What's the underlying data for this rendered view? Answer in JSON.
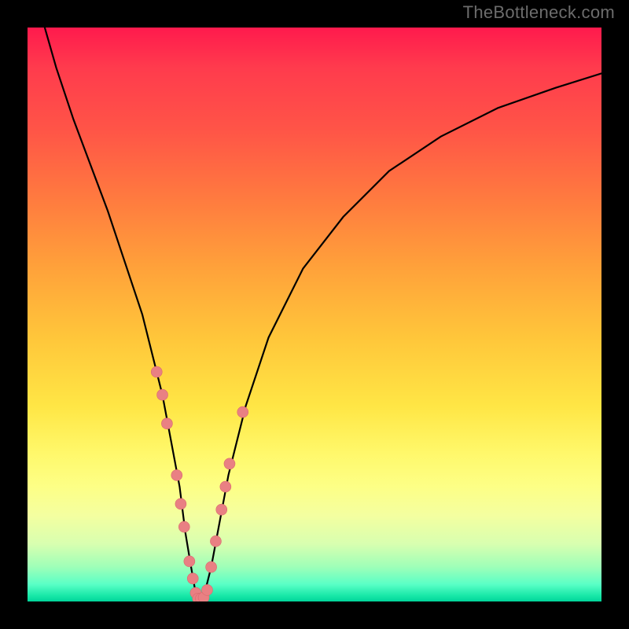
{
  "watermark": "TheBottleneck.com",
  "colors": {
    "curve": "#000000",
    "marker_fill": "#e98083",
    "marker_stroke": "#d96a6d"
  },
  "chart_data": {
    "type": "line",
    "title": "",
    "xlabel": "",
    "ylabel": "",
    "xlim": [
      0,
      100
    ],
    "ylim": [
      0,
      100
    ],
    "grid": false,
    "legend": false,
    "annotations": [
      "TheBottleneck.com"
    ],
    "series": [
      {
        "name": "bottleneck-curve",
        "x": [
          3,
          5,
          8,
          11,
          14,
          17,
          20,
          22,
          23.5,
          25,
          26.5,
          27.5,
          28.5,
          29.2,
          30,
          31,
          32,
          33.5,
          35,
          38,
          42,
          48,
          55,
          63,
          72,
          82,
          92,
          100
        ],
        "y": [
          100,
          93,
          84,
          76,
          68,
          59,
          50,
          42,
          36,
          28,
          20,
          12,
          6,
          2,
          0,
          2,
          6,
          14,
          22,
          34,
          46,
          58,
          67,
          75,
          81,
          86,
          89.5,
          92
        ]
      }
    ],
    "markers": [
      {
        "x": 22.5,
        "y": 40,
        "r": 7
      },
      {
        "x": 23.5,
        "y": 36,
        "r": 7
      },
      {
        "x": 24.3,
        "y": 31,
        "r": 7
      },
      {
        "x": 26.0,
        "y": 22,
        "r": 7
      },
      {
        "x": 26.7,
        "y": 17,
        "r": 7
      },
      {
        "x": 27.3,
        "y": 13,
        "r": 7
      },
      {
        "x": 28.2,
        "y": 7,
        "r": 7
      },
      {
        "x": 28.8,
        "y": 4,
        "r": 7
      },
      {
        "x": 29.3,
        "y": 1.5,
        "r": 7
      },
      {
        "x": 29.7,
        "y": 0.5,
        "r": 7
      },
      {
        "x": 30.2,
        "y": 0.5,
        "r": 7
      },
      {
        "x": 30.7,
        "y": 0.7,
        "r": 7
      },
      {
        "x": 31.3,
        "y": 2,
        "r": 7
      },
      {
        "x": 32.0,
        "y": 6,
        "r": 7
      },
      {
        "x": 32.8,
        "y": 10.5,
        "r": 7
      },
      {
        "x": 33.8,
        "y": 16,
        "r": 7
      },
      {
        "x": 34.5,
        "y": 20,
        "r": 7
      },
      {
        "x": 35.2,
        "y": 24,
        "r": 7
      },
      {
        "x": 37.5,
        "y": 33,
        "r": 7
      }
    ]
  }
}
